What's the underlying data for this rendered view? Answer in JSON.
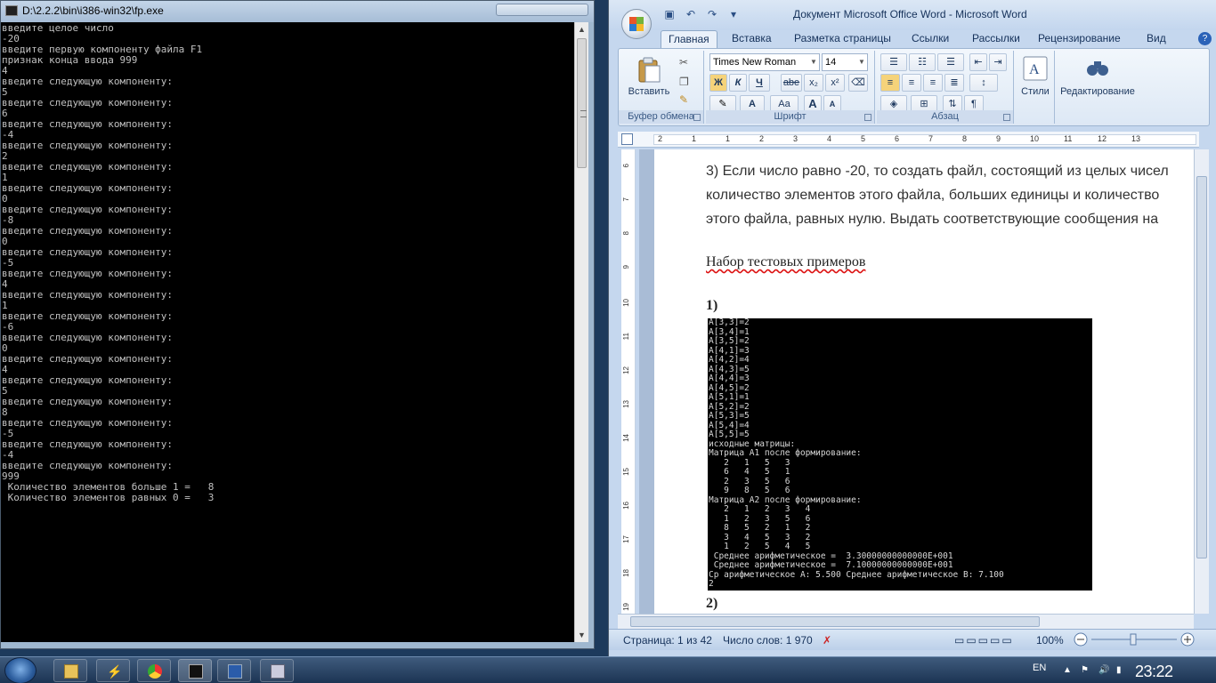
{
  "console": {
    "title": "D:\\2.2.2\\bin\\i386-win32\\fp.exe",
    "lines": [
      "введите целое число",
      "-20",
      "введите первую компоненту файла F1",
      "признак конца ввода 999",
      "4",
      "введите следующую компоненту:",
      "5",
      "введите следующую компоненту:",
      "6",
      "введите следующую компоненту:",
      "-4",
      "введите следующую компоненту:",
      "2",
      "введите следующую компоненту:",
      "1",
      "введите следующую компоненту:",
      "0",
      "введите следующую компоненту:",
      "-8",
      "введите следующую компоненту:",
      "0",
      "введите следующую компоненту:",
      "-5",
      "введите следующую компоненту:",
      "4",
      "введите следующую компоненту:",
      "1",
      "введите следующую компоненту:",
      "-6",
      "введите следующую компоненту:",
      "0",
      "введите следующую компоненту:",
      "4",
      "введите следующую компоненту:",
      "5",
      "введите следующую компоненту:",
      "8",
      "введите следующую компоненту:",
      "-5",
      "введите следующую компоненту:",
      "-4",
      "введите следующую компоненту:",
      "999",
      " Количество элементов больше 1 =   8",
      " Количество элементов равных 0 =   3"
    ]
  },
  "word": {
    "title": "Документ Microsoft Office Word - Microsoft Word",
    "tabs": [
      "Главная",
      "Вставка",
      "Разметка страницы",
      "Ссылки",
      "Рассылки",
      "Рецензирование",
      "Вид"
    ],
    "ribbon": {
      "paste_label": "Вставить",
      "clipboard_label": "Буфер обмена",
      "font_name": "Times New Roman",
      "font_size": "14",
      "font_label": "Шрифт",
      "paragraph_label": "Абзац",
      "styles_label": "Стили",
      "editing_label": "Редактирование",
      "bold": "Ж",
      "italic": "К",
      "underline": "Ч",
      "strike": "abe",
      "sub": "x₂",
      "sup": "x²",
      "case": "Aa",
      "grow": "A",
      "shrink": "A"
    },
    "ruler_numbers": [
      "2",
      "1",
      "1",
      "2",
      "3",
      "4",
      "5",
      "6",
      "7",
      "8",
      "9",
      "10",
      "11",
      "12",
      "13"
    ],
    "vruler_numbers": [
      "6",
      "7",
      "8",
      "9",
      "10",
      "11",
      "12",
      "13",
      "14",
      "15",
      "16",
      "17",
      "18",
      "19"
    ],
    "doc": {
      "line1": "3) Если число равно -20, то создать файл, состоящий из целых чисел",
      "line2": "количество элементов этого файла, больших единицы и количество",
      "line3": "этого файла, равных нулю. Выдать соответствующие сообщения на",
      "heading": "Набор тестовых примеров",
      "ex1": "1)",
      "ex2": "2)"
    },
    "screenshot_lines": [
      "A[3,3]=2",
      "A[3,4]=1",
      "A[3,5]=2",
      "A[4,1]=3",
      "A[4,2]=4",
      "A[4,3]=5",
      "A[4,4]=3",
      "A[4,5]=2",
      "A[5,1]=1",
      "A[5,2]=2",
      "A[5,3]=5",
      "A[5,4]=4",
      "A[5,5]=5",
      "исходные матрицы:",
      "Матрица A1 после формирование:",
      "   2   1   5   3",
      "   6   4   5   1",
      "   2   3   5   6",
      "   9   8   5   6",
      "Матрица A2 после формирование:",
      "   2   1   2   3   4",
      "   1   2   3   5   6",
      "   8   5   2   1   2",
      "   3   4   5   3   2",
      "   1   2   5   4   5",
      " Среднее арифметическое =  3.30000000000000E+001",
      " Среднее арифметическое =  7.10000000000000E+001",
      "Ср арифметическое A: 5.500 Среднее арифметическое B: 7.100",
      "2"
    ],
    "status": {
      "page": "Страница: 1 из 42",
      "words": "Число слов: 1 970",
      "zoom": "100%"
    }
  },
  "taskbar": {
    "lang": "EN",
    "clock": "23:22"
  }
}
